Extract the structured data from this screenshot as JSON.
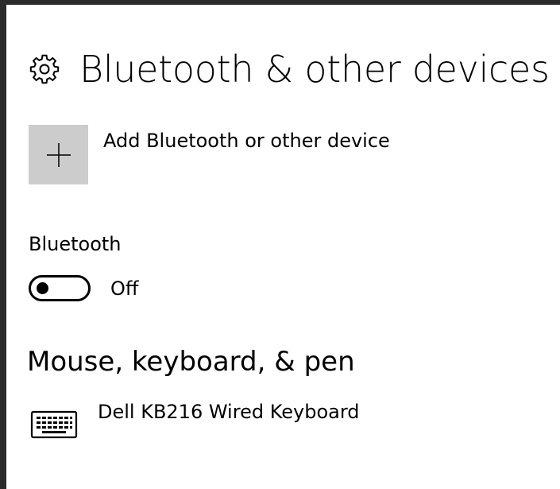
{
  "page": {
    "title": "Bluetooth & other devices",
    "title_icon": "gear-icon"
  },
  "add_device": {
    "label": "Add Bluetooth or other device",
    "icon": "plus-icon",
    "tile_color": "#cccccc"
  },
  "bluetooth": {
    "label": "Bluetooth",
    "state_label": "Off",
    "on": false
  },
  "mouse_keyboard_pen": {
    "heading": "Mouse, keyboard, & pen",
    "devices": [
      {
        "name": "Dell KB216 Wired Keyboard",
        "icon": "keyboard-icon"
      }
    ]
  }
}
